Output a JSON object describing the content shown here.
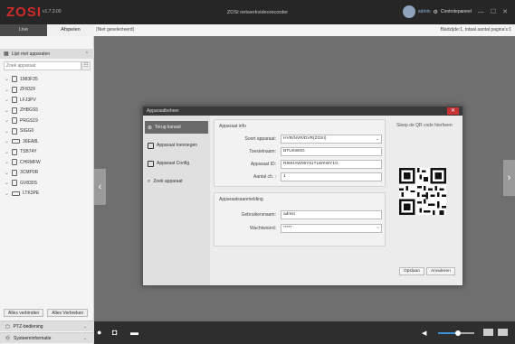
{
  "app": {
    "logo": "ZOSI",
    "version": "v1.7.3.00",
    "title": "ZOSI netwerkvideorecorder",
    "user_name": "admin",
    "control_center": "Controlepaneel"
  },
  "sidebar": {
    "tabs": [
      "Live",
      "Afspelen"
    ],
    "device_list_header": "Lijst met apparaten",
    "search_placeholder": "Zoek apparaat",
    "devices": [
      {
        "name": "1983F35",
        "type": "camera"
      },
      {
        "name": "ZF832F",
        "type": "camera"
      },
      {
        "name": "LFJ3PV",
        "type": "camera"
      },
      {
        "name": "ZHBGS5",
        "type": "camera"
      },
      {
        "name": "PRGS19",
        "type": "camera"
      },
      {
        "name": "SIGG0",
        "type": "camera"
      },
      {
        "name": "36EA8L",
        "type": "dvr"
      },
      {
        "name": "TSB74Y",
        "type": "camera"
      },
      {
        "name": "CHRMFW",
        "type": "camera"
      },
      {
        "name": "3CMP0R",
        "type": "camera"
      },
      {
        "name": "GV830S",
        "type": "camera"
      },
      {
        "name": "LTK3PE",
        "type": "dvr"
      }
    ],
    "buttons": [
      "Alles verbinden",
      "Alles Verbreken"
    ],
    "bottom_menu": [
      "PTZ-bediening",
      "Systeeminformatie"
    ]
  },
  "topinfo": {
    "left": "(Niet geselecteerd)",
    "right": "Bladzijde:1, totaal aantal pagina's:1"
  },
  "dialog": {
    "title": "Apparaatbeheer",
    "nav": [
      "Terug kanaal",
      "Apparaat toevoegen",
      "Apparaat Config",
      "Zoek apparaat"
    ],
    "info_title": "Apparaat info",
    "fields": {
      "device_type": {
        "label": "Soort apparaat:",
        "value": "HVR/NVR/DVR(ZOSI)"
      },
      "device_name": {
        "label": "Toestelnaam:",
        "value": "BTUKW0G"
      },
      "device_id": {
        "label": "Apparaat ID:",
        "value": "R89HAW05Y51TLWKWY1G"
      },
      "channels": {
        "label": "Aantal ch. :",
        "value": "1"
      }
    },
    "login_title": "Apparaatsaanmelding",
    "login_fields": {
      "username": {
        "label": "Gebruikersnaam:",
        "value": "admin"
      },
      "password": {
        "label": "Wachtwoord:",
        "value": "*****"
      }
    },
    "qr_hint": "Sleep de QR code hierheen",
    "buttons": [
      "Opslaan",
      "Annuleren"
    ]
  },
  "colors": {
    "accent": "#d22b2b",
    "active_tab": "#4a4a4a",
    "volume": "#3a8ed6"
  },
  "bottom_bar": {
    "volume_level": 0.55
  }
}
